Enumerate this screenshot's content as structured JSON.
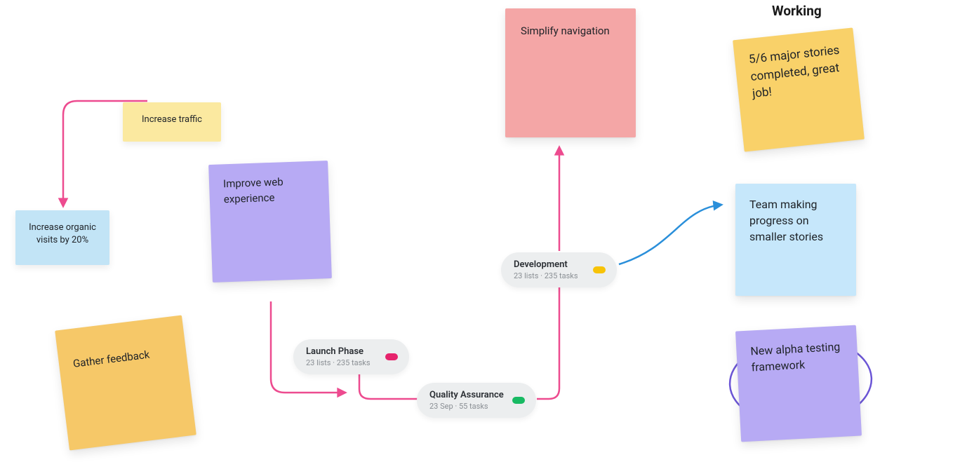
{
  "heading": {
    "working": "Working"
  },
  "notes": {
    "increase_organic": "Increase organic visits by 20%",
    "increase_traffic": "Increase traffic",
    "improve_web": "Improve web experience",
    "gather_feedback": "Gather feedback",
    "simplify_navigation": "Simplify navigation",
    "stories_completed": "5/6 major stories completed, great job!",
    "team_progress": "Team making progress on smaller stories",
    "alpha_testing": "New alpha testing framework"
  },
  "pills": {
    "launch": {
      "title": "Launch Phase",
      "sub": "23 lists · 235 tasks",
      "dot_color": "#e6236c"
    },
    "qa": {
      "title": "Quality Assurance",
      "sub": "23 Sep · 55 tasks",
      "dot_color": "#18ba63"
    },
    "dev": {
      "title": "Development",
      "sub": "23 lists · 235 tasks",
      "dot_color": "#f7c307"
    }
  },
  "colors": {
    "blue_note": "#c2e4f6",
    "yellow_small": "#fbe9a0",
    "purple_note": "#b7aaf4",
    "orange_note": "#f6c868",
    "pink_large": "#f4a6a6",
    "yellow_right": "#f9d169",
    "blue_right": "#c6e7fb",
    "purple_right": "#b7aaf4",
    "arrow_pink": "#ed4b8f",
    "arrow_blue": "#2a8fda",
    "circle_green": "#1fb56b",
    "circle_purple": "#6b55d6"
  }
}
